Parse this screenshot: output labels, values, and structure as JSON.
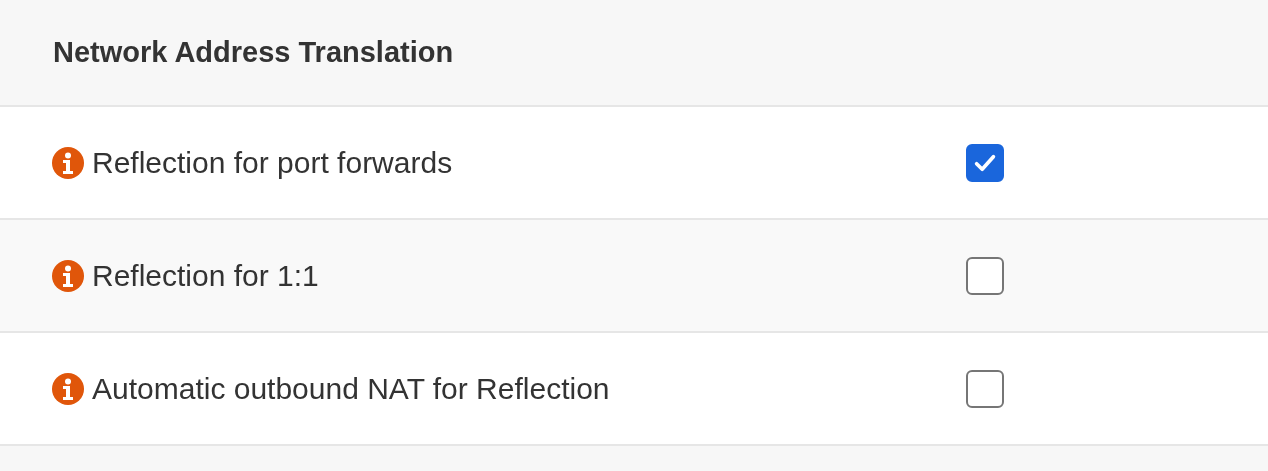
{
  "section": {
    "title": "Network Address Translation"
  },
  "options": [
    {
      "label": "Reflection for port forwards",
      "checked": true
    },
    {
      "label": "Reflection for 1:1",
      "checked": false
    },
    {
      "label": "Automatic outbound NAT for Reflection",
      "checked": false
    }
  ]
}
